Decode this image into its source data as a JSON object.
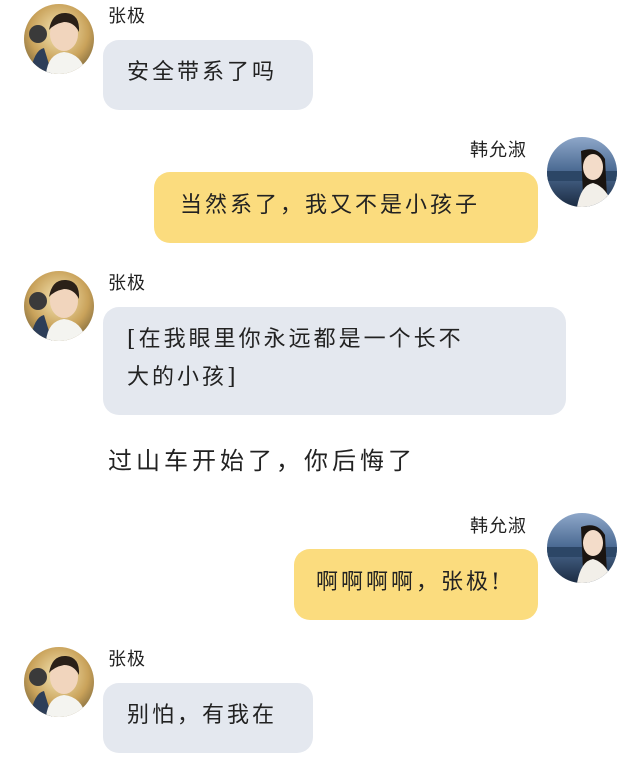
{
  "chat": {
    "names": {
      "left": "张极",
      "right": "韩允淑"
    },
    "messages": [
      {
        "sender": "张极",
        "side": "left",
        "text": "安全带系了吗"
      },
      {
        "sender": "韩允淑",
        "side": "right",
        "text": "当然系了，我又不是小孩子"
      },
      {
        "sender": "张极",
        "side": "left",
        "line1": "[在我眼里你永远都是一个长不",
        "line2": "大的小孩]"
      },
      {
        "sender": "",
        "side": "narration",
        "text": "过山车开始了，你后悔了"
      },
      {
        "sender": "韩允淑",
        "side": "right",
        "text": "啊啊啊啊，张极!"
      },
      {
        "sender": "张极",
        "side": "left",
        "text": "别怕，有我在"
      }
    ]
  },
  "colors": {
    "left_bubble": "#e4e8ef",
    "right_bubble": "#fbdc7e",
    "background": "#ffffff"
  },
  "icons": {
    "left_avatar": "boy-portrait-avatar",
    "right_avatar": "girl-portrait-avatar"
  }
}
